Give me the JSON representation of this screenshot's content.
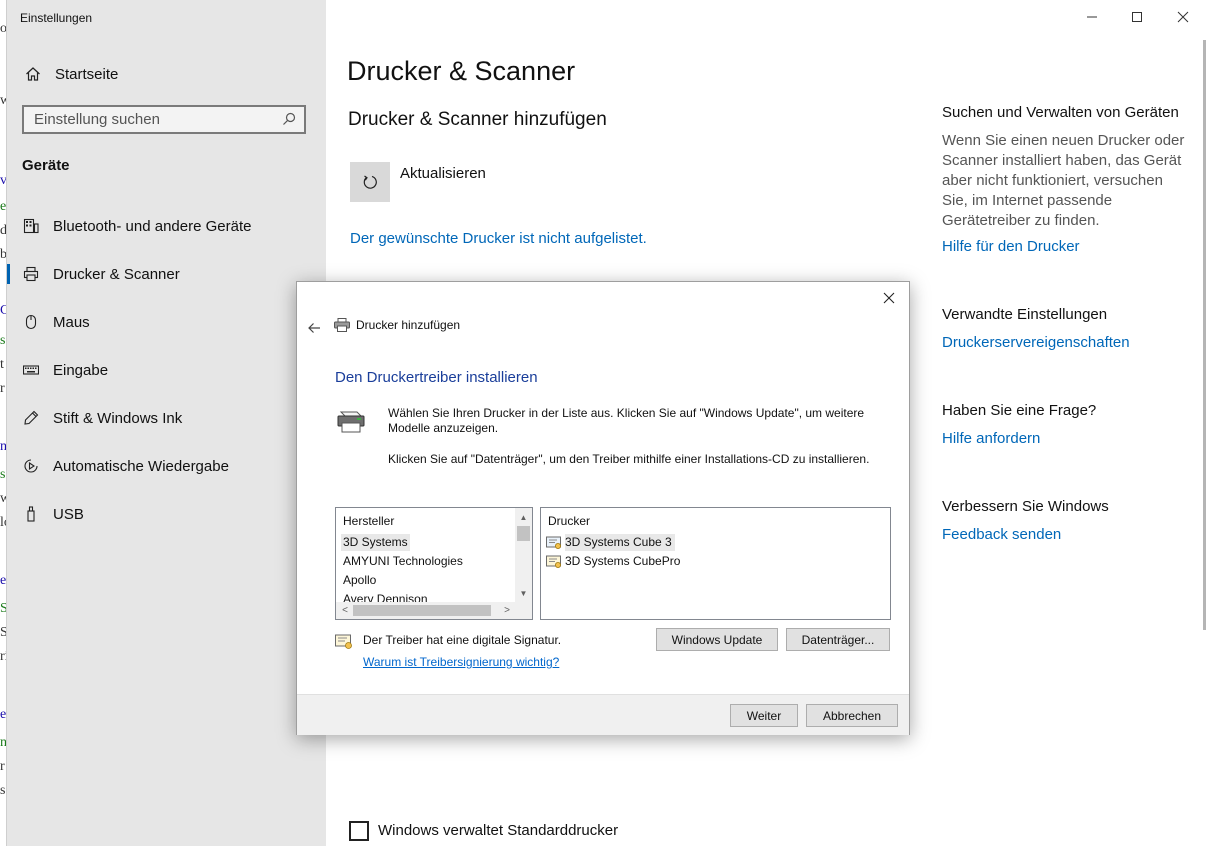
{
  "window": {
    "title": "Einstellungen"
  },
  "sidebar": {
    "home_label": "Startseite",
    "search_placeholder": "Einstellung suchen",
    "group_title": "Geräte",
    "items": [
      {
        "label": "Bluetooth- und andere Geräte",
        "icon": "bluetooth-devices-icon"
      },
      {
        "label": "Drucker & Scanner",
        "icon": "printer-icon",
        "active": true
      },
      {
        "label": "Maus",
        "icon": "mouse-icon"
      },
      {
        "label": "Eingabe",
        "icon": "keyboard-icon"
      },
      {
        "label": "Stift & Windows Ink",
        "icon": "pen-icon"
      },
      {
        "label": "Automatische Wiedergabe",
        "icon": "autoplay-icon"
      },
      {
        "label": "USB",
        "icon": "usb-icon"
      }
    ]
  },
  "main": {
    "title": "Drucker & Scanner",
    "subtitle": "Drucker & Scanner hinzufügen",
    "refresh_label": "Aktualisieren",
    "printer_missing_link": "Der gewünschte Drucker ist nicht aufgelistet.",
    "default_printer_checkbox": "Windows verwaltet Standarddrucker",
    "default_printer_checked": false
  },
  "right_panel": {
    "find_heading": "Suchen und Verwalten von Geräten",
    "find_text": "Wenn Sie einen neuen Drucker oder Scanner installiert haben, das Gerät aber nicht funktioniert, versuchen Sie, im Internet passende Gerätetreiber zu finden.",
    "find_link": "Hilfe für den Drucker",
    "related_heading": "Verwandte Einstellungen",
    "related_link": "Druckerservereigenschaften",
    "question_heading": "Haben Sie eine Frage?",
    "question_link": "Hilfe anfordern",
    "improve_heading": "Verbessern Sie Windows",
    "improve_link": "Feedback senden"
  },
  "dialog": {
    "header": "Drucker hinzufügen",
    "title": "Den Druckertreiber installieren",
    "text1": "Wählen Sie Ihren Drucker in der Liste aus. Klicken Sie auf \"Windows Update\", um weitere Modelle anzuzeigen.",
    "text2": "Klicken Sie auf \"Datenträger\", um den Treiber mithilfe einer Installations-CD zu installieren.",
    "manufacturer_header": "Hersteller",
    "manufacturers": [
      "3D Systems",
      "AMYUNI Technologies",
      "Apollo",
      "Avery Dennison"
    ],
    "selected_manufacturer": "3D Systems",
    "printer_header": "Drucker",
    "printers": [
      "3D Systems Cube 3",
      "3D Systems CubePro"
    ],
    "selected_printer": "3D Systems Cube 3",
    "signature_text": "Der Treiber hat eine digitale Signatur.",
    "signature_link": "Warum ist Treibersignierung wichtig?",
    "windows_update_button": "Windows Update",
    "disk_button": "Datenträger...",
    "next_button": "Weiter",
    "cancel_button": "Abbrechen"
  },
  "colors": {
    "accent": "#0063b1",
    "link": "#0067b8",
    "sidebar_bg": "#e6e6e6",
    "dialog_title": "#1a3e9a"
  }
}
